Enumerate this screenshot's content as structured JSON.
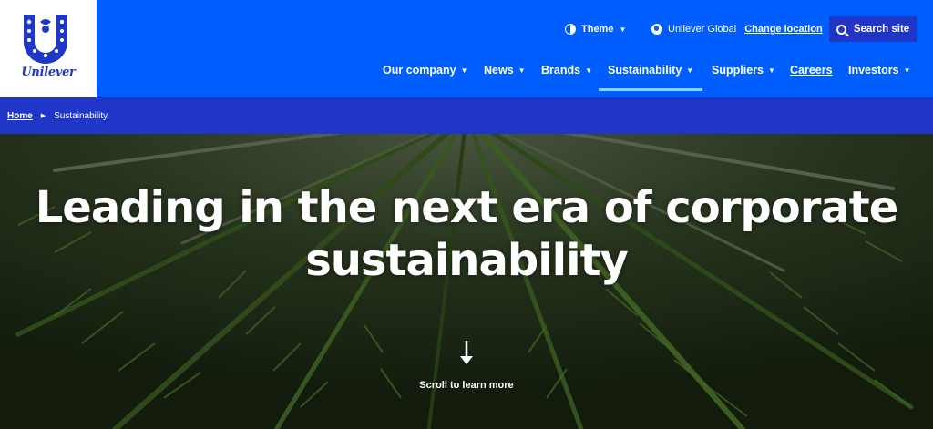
{
  "brand": {
    "name": "Unilever"
  },
  "utility": {
    "theme_label": "Theme",
    "location_label": "Unilever Global",
    "change_location": "Change location",
    "search_label": "Search site"
  },
  "nav": {
    "items": [
      {
        "label": "Our company",
        "has_menu": true
      },
      {
        "label": "News",
        "has_menu": true
      },
      {
        "label": "Brands",
        "has_menu": true
      },
      {
        "label": "Sustainability",
        "has_menu": true,
        "active": true
      },
      {
        "label": "Suppliers",
        "has_menu": true
      },
      {
        "label": "Careers",
        "has_menu": false
      },
      {
        "label": "Investors",
        "has_menu": true
      }
    ]
  },
  "breadcrumb": {
    "home": "Home",
    "current": "Sustainability"
  },
  "hero": {
    "title_line1": "Leading in the next era of corporate",
    "title_line2": "sustainability",
    "scroll_label": "Scroll to learn more"
  },
  "icons": {
    "caret": "▼",
    "breadcrumb_sep": "▶"
  },
  "colors": {
    "header_blue": "#005eff",
    "breadcrumb_blue": "#1f36c7",
    "active_underline": "#8dd6ff",
    "logo_blue": "#1f36c7"
  }
}
